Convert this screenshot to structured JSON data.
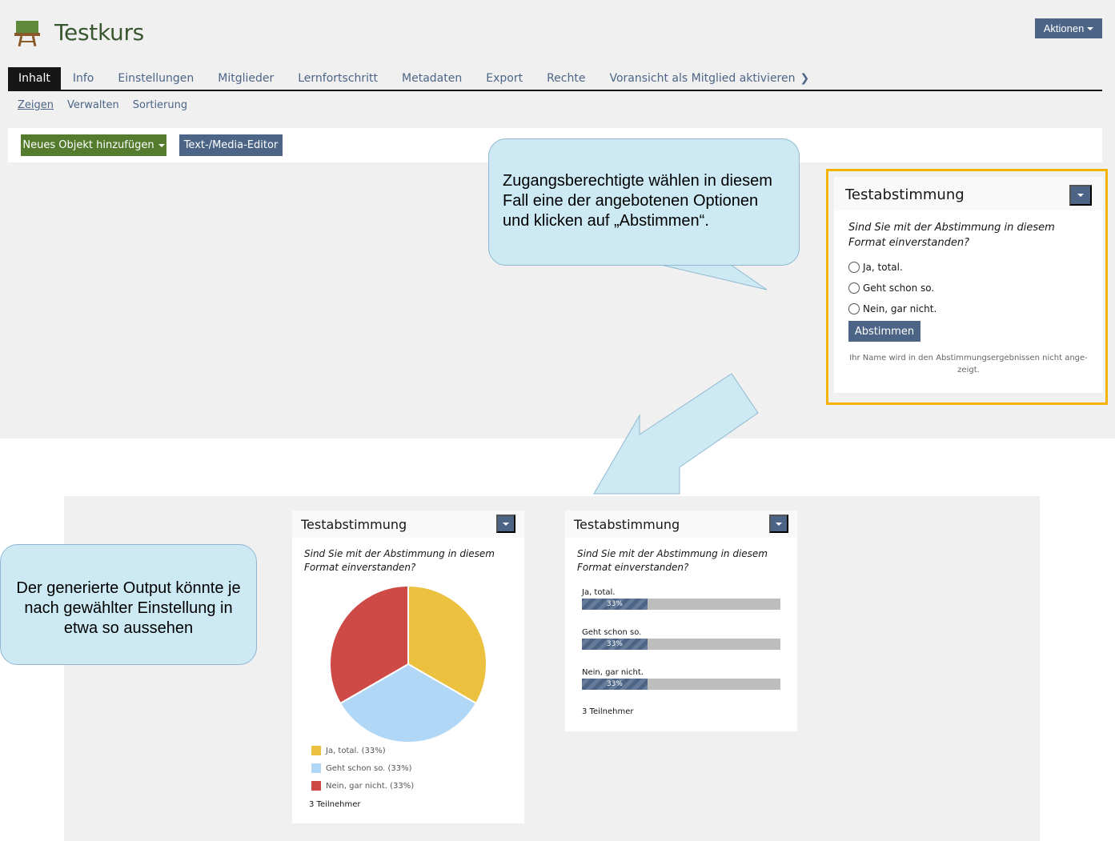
{
  "header": {
    "title": "Testkurs",
    "actions_label": "Aktionen"
  },
  "tabs": [
    {
      "label": "Inhalt",
      "active": true
    },
    {
      "label": "Info"
    },
    {
      "label": "Einstellungen"
    },
    {
      "label": "Mitglieder"
    },
    {
      "label": "Lernfortschritt"
    },
    {
      "label": "Metadaten"
    },
    {
      "label": "Export"
    },
    {
      "label": "Rechte"
    },
    {
      "label": "Voransicht als Mitglied aktivieren"
    }
  ],
  "subtabs": [
    {
      "label": "Zeigen",
      "active": true
    },
    {
      "label": "Verwalten"
    },
    {
      "label": "Sortierung"
    }
  ],
  "toolbar": {
    "add_label": "Neues Objekt hinzufügen",
    "editor_label": "Text-/Media-Editor"
  },
  "poll": {
    "title": "Testabstimmung",
    "question": "Sind Sie mit der Abstimmung in diesem Format einverstanden?",
    "options": [
      "Ja, total.",
      "Geht schon so.",
      "Nein, gar nicht."
    ],
    "vote_label": "Abstimmen",
    "note": "Ihr Name wird in den Abstimmungsergebnissen nicht ange-zeigt."
  },
  "callouts": {
    "top": "Zugangsberechtigte wählen in diesem Fall eine der angebotenen Optionen und klicken auf „Abstimmen“.",
    "left": "Der generierte Output könnte je nach gewählter Einstellung in etwa so aussehen"
  },
  "results": {
    "title": "Testabstimmung",
    "question": "Sind Sie mit der Abstimmung in diesem Format einverstanden?",
    "participants": "3 Teilnehmer",
    "legend": [
      "Ja, total. (33%)",
      "Geht schon so. (33%)",
      "Nein, gar nicht. (33%)"
    ],
    "bar_options": [
      "Ja, total.",
      "Geht schon so.",
      "Nein, gar nicht."
    ],
    "bar_texts": [
      "33%",
      "33%",
      "33%"
    ]
  },
  "colors": {
    "accent": "#4c6586",
    "green": "#557b2e",
    "highlight": "#f4b400",
    "callout": "#cdeaf4"
  },
  "chart_data": [
    {
      "type": "pie",
      "categories": [
        "Ja, total.",
        "Geht schon so.",
        "Nein, gar nicht."
      ],
      "values": [
        33,
        33,
        33
      ],
      "colors": [
        "#ecc140",
        "#b1d7f6",
        "#cd4a47"
      ],
      "title": "",
      "legend": "bottom"
    },
    {
      "type": "bar",
      "orientation": "horizontal",
      "categories": [
        "Ja, total.",
        "Geht schon so.",
        "Nein, gar nicht."
      ],
      "values": [
        33,
        33,
        33
      ],
      "xlim": [
        0,
        100
      ]
    }
  ]
}
